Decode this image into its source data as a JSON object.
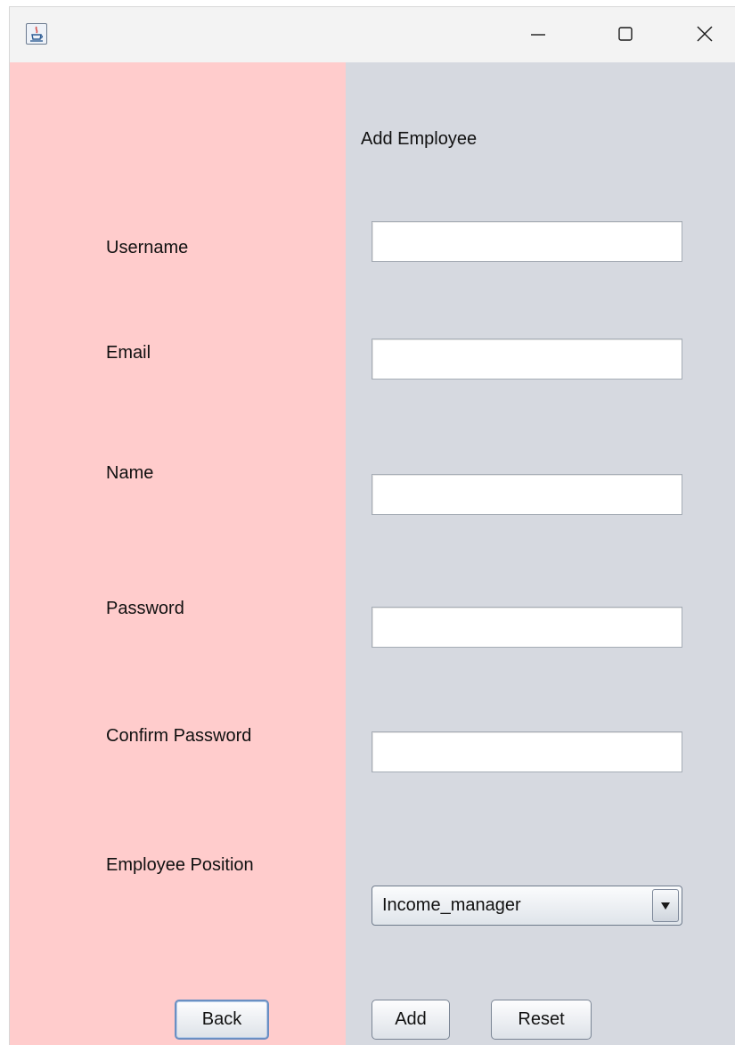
{
  "window": {
    "icon": "java-cup-icon",
    "controls": {
      "minimize": "minimize-icon",
      "maximize": "maximize-icon",
      "close": "close-icon"
    }
  },
  "form": {
    "title": "Add Employee",
    "fields": {
      "username": {
        "label": "Username",
        "value": ""
      },
      "email": {
        "label": "Email",
        "value": ""
      },
      "name": {
        "label": "Name",
        "value": ""
      },
      "password": {
        "label": "Password",
        "value": ""
      },
      "confirm_password": {
        "label": "Confirm Password",
        "value": ""
      }
    },
    "position": {
      "label": "Employee Position",
      "selected": "Income_manager"
    }
  },
  "buttons": {
    "back": "Back",
    "add": "Add",
    "reset": "Reset"
  },
  "colors": {
    "left_panel": "#ffcccc",
    "right_panel": "#d6d9e0",
    "title_bar": "#f3f3f3"
  }
}
